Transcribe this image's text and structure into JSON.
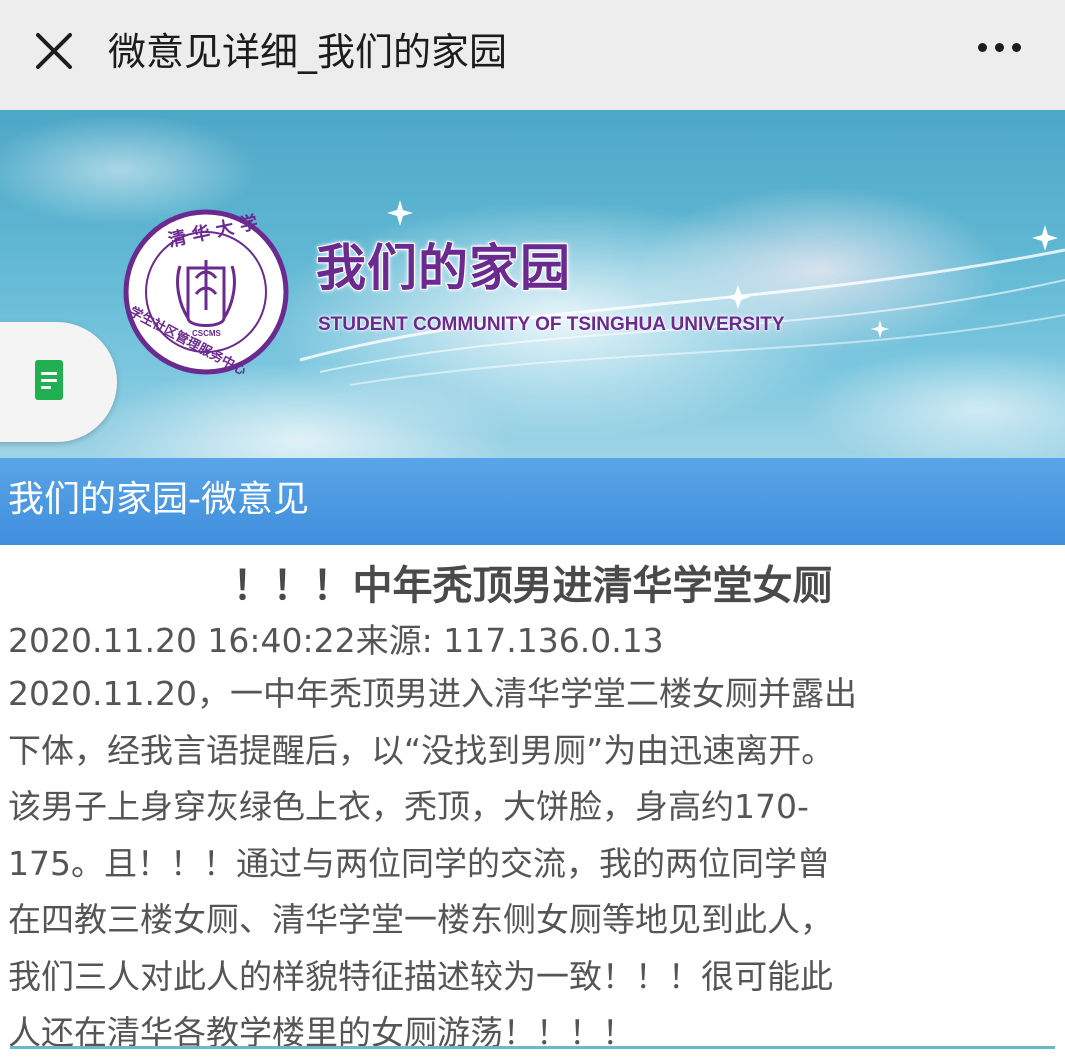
{
  "topbar": {
    "title": "微意见详细_我们的家园",
    "close_icon": "close-icon",
    "more_icon": "more-icon"
  },
  "banner": {
    "title": "我们的家园",
    "subtitle": "STUDENT COMMUNITY OF TSINGHUA UNIVERSITY",
    "emblem": {
      "top_text": "清华大学",
      "ring_text": "学生社区管理服务中心",
      "center_text": "CSCMS"
    },
    "doc_tab_icon": "document-icon"
  },
  "section": {
    "label": "我们的家园-微意见"
  },
  "article": {
    "title": "！！！中年秃顶男进清华学堂女厕",
    "meta": "2020.11.20 16:40:22来源: 117.136.0.13",
    "body_lines": [
      "2020.11.20，一中年秃顶男进入清华学堂二楼女厕并露出",
      "下体，经我言语提醒后，以“没找到男厕”为由迅速离开。",
      "该男子上身穿灰绿色上衣，秃顶，大饼脸，身高约170-",
      "175。且！！！通过与两位同学的交流，我的两位同学曾",
      "在四教三楼女厕、清华学堂一楼东侧女厕等地见到此人，",
      "我们三人对此人的样貌特征描述较为一致！！！很可能此",
      "人还在清华各教学楼里的女厕游荡！！！！"
    ]
  },
  "colors": {
    "topbar_bg": "#ededed",
    "section_bar": "#4a97e0",
    "banner_title": "#6b2a90",
    "body_text": "#555555"
  }
}
